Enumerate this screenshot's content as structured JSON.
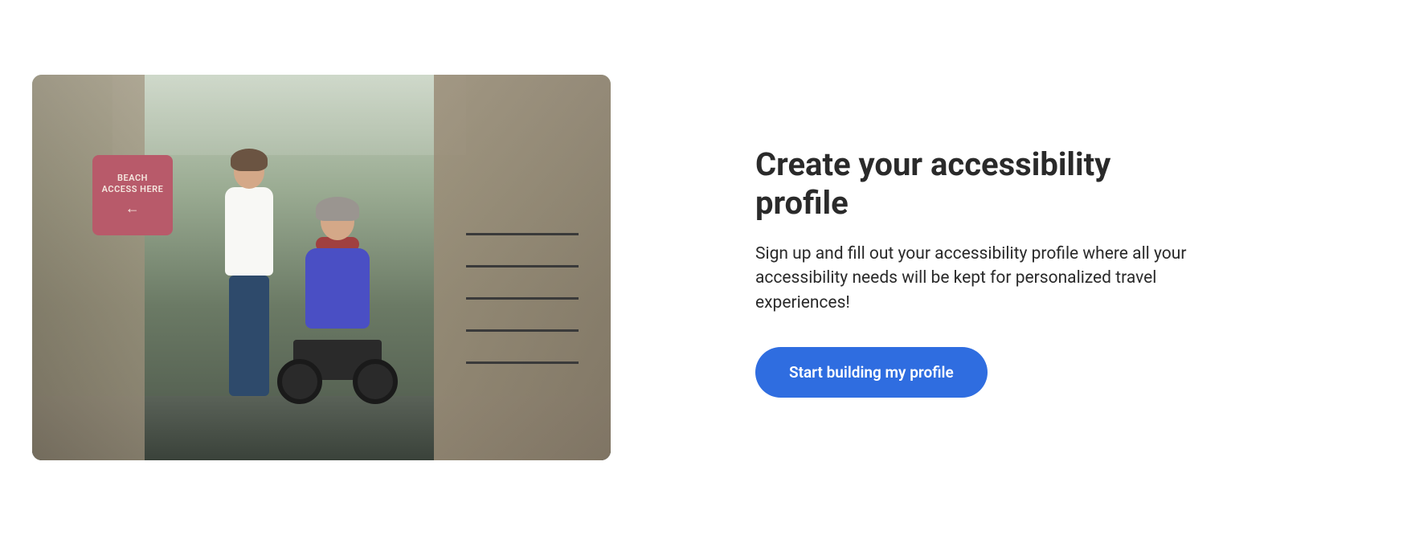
{
  "hero": {
    "image_alt": "Two people at a boardwalk entrance, one walking and one using a power wheelchair, near a Beach Access Here sign",
    "sign_text": "BEACH ACCESS HERE"
  },
  "content": {
    "heading": "Create your accessibility profile",
    "description": "Sign up and fill out your accessibility profile where all your accessibility needs will be kept for personalized travel experiences!",
    "cta_label": "Start building my profile"
  },
  "colors": {
    "primary": "#2f6de0",
    "text": "#2a2a2a"
  }
}
